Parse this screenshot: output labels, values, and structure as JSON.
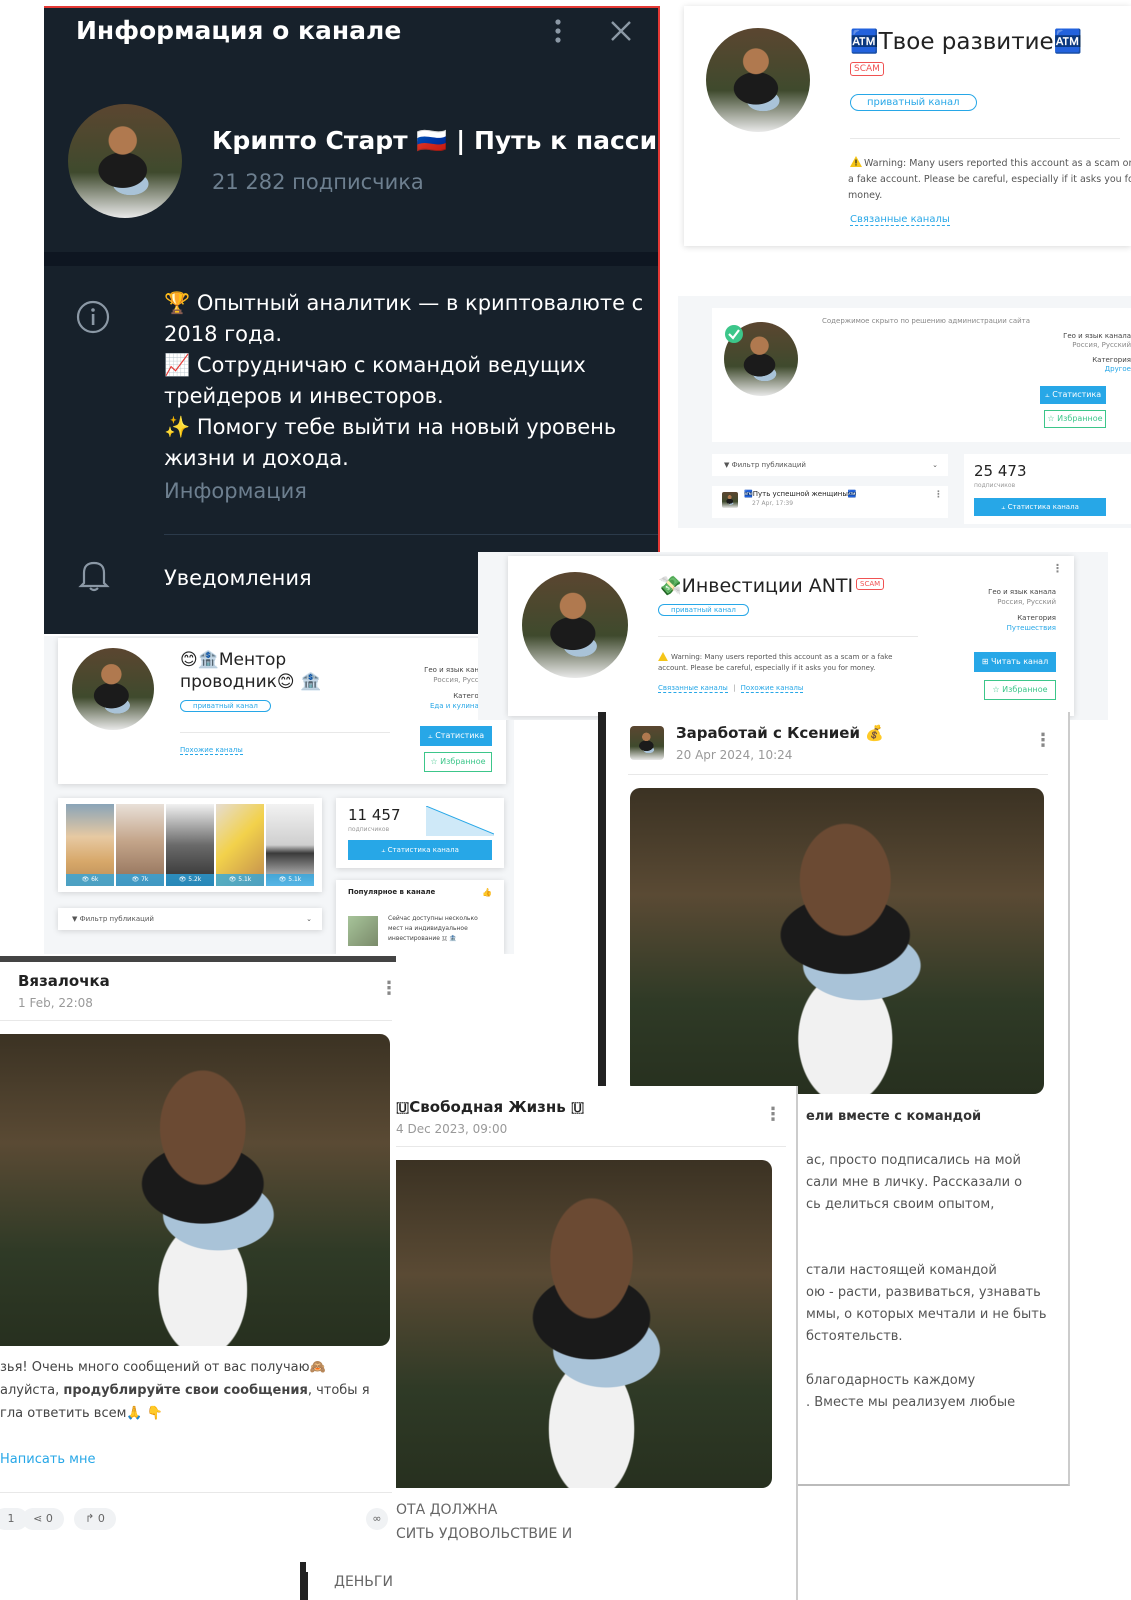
{
  "tg_info": {
    "header_title": "Информация о канале",
    "channel_name": "Крипто Старт 🇷🇺 | Путь к пасси...",
    "subscribers": "21 282 подписчика",
    "bio_lines": [
      "🏆 Опытный аналитик — в криптовалюте с",
      "2018 года.",
      "📈 Сотрудничаю с командой ведущих",
      "трейдеров и инвесторов.",
      "✨ Помогу тебе выйти на новый уровень",
      "жизни и дохода."
    ],
    "bio_caption": "Информация",
    "notifications_label": "Уведомления"
  },
  "card_razvitie": {
    "title": "🏧Твое развитие🏧",
    "scam": "SCAM",
    "tag": "приватный канал",
    "warning": "Warning: Many users reported this account as a scam or a fake account. Please be careful, especially if it asks you for money.",
    "related_link": "Связанные каналы"
  },
  "card_hidden": {
    "notice": "Содержимое скрыто по решению администрации сайта",
    "geo_label": "Гео и язык канала",
    "geo_value": "Россия, Русский",
    "category_label": "Категория",
    "category_value": "Другое",
    "stats_button": "Статистика",
    "fav_button": "Избранное",
    "filter_label": "Фильтр публикаций",
    "subs_count": "25 473",
    "subs_label": "подписчиков",
    "channel_stats_button": "Статистика канала",
    "post_title": "🏧Путь успешной женщины🏧",
    "post_date": "27 Apr, 17:39"
  },
  "card_anti": {
    "title": "💸Инвестиции ANTI",
    "scam": "SCAM",
    "tag": "приватный канал",
    "warning": "Warning: Many users reported this account as a scam or a fake account. Please be careful, especially if it asks you for money.",
    "related_link": "Связанные каналы",
    "similar_link": "Похожие каналы",
    "separator": "|",
    "geo_label": "Гео и язык канала",
    "geo_value": "Россия, Русский",
    "category_label": "Категория",
    "category_value": "Путешествия",
    "read_button": "Читать канал",
    "fav_button": "Избранное"
  },
  "card_mentor": {
    "title_line1": "😊🏦Ментор",
    "title_line2": "проводник😊 🏦",
    "tag": "приватный канал",
    "similar_link": "Похожие каналы",
    "geo_label": "Гео и язык канала",
    "geo_value": "Россия, Русский",
    "category_label": "Категория",
    "category_value": "Еда и кулинария",
    "stats_button": "Статистика",
    "fav_button": "Избранное",
    "thumb_views": [
      "6k",
      "7k",
      "5.2k",
      "5.1k",
      "5.1k"
    ],
    "subs_count": "11 457",
    "subs_label": "подписчиков",
    "channel_stats_button": "Статистика канала",
    "popular_label": "Популярное в канале",
    "popular_text_lines": [
      "Сейчас доступны несколько",
      "мест на индивидуальное",
      "инвестирование 🇺 🏦"
    ],
    "filter_label": "Фильтр публикаций"
  },
  "post_ksenia": {
    "author": "Заработай с Ксенией 💰",
    "date": "20 Apr 2024, 10:24",
    "text_lines": [
      "ели вместе с командой",
      "",
      "ас, просто подписались на мой",
      "сали мне в личку. Рассказали о",
      "сь делиться своим опытом,",
      "",
      "",
      "стали настоящей командой",
      "ою - расти, развиваться, узнавать",
      "ммы, о которых мечтали и не быть",
      "бстоятельств.",
      "",
      "благодарность каждому",
      ". Вместе мы реализуем любые"
    ]
  },
  "post_vyazalochka": {
    "author": "Вязалочка",
    "date": "1 Feb, 22:08",
    "text_line1": "зья! Очень много сообщений от вас получаю🙈",
    "text_line2_pre": "алуйста, ",
    "text_line2_bold": "продублируйте свои сообщения",
    "text_line2_post": ", чтобы я",
    "text_line3": "гла ответить всем🙏 👇",
    "write_link": "Написать мне",
    "stat1": "1",
    "stat_shares": "0",
    "stat_forwards": "0"
  },
  "post_svobodnaya": {
    "author": "🇺Свободная Жизнь 🇺",
    "date": "4 Dec 2023, 09:00",
    "caps_lines": [
      "ОТА ДОЛЖНА",
      "СИТЬ УДОВОЛЬСТВИЕ И",
      "ДЕНЬГИ"
    ]
  },
  "colors": {
    "telegram_dark": "#17212b",
    "accent_blue": "#27a7e7",
    "scam_red": "#f05252",
    "fav_green": "#3cc68a"
  }
}
